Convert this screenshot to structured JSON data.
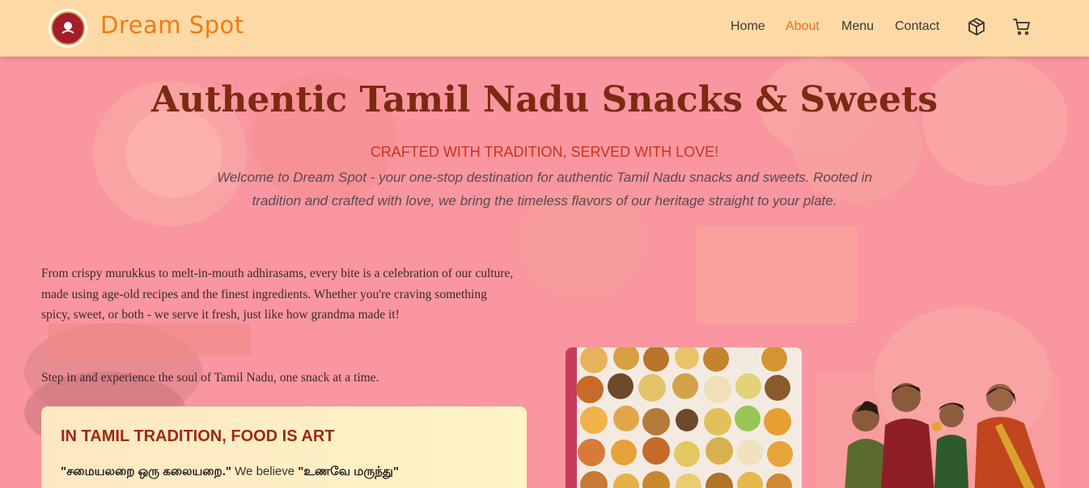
{
  "nav": {
    "brand": "Dream Spot",
    "items": [
      {
        "label": "Home"
      },
      {
        "label": "About"
      },
      {
        "label": "Menu"
      },
      {
        "label": "Contact"
      }
    ]
  },
  "hero": {
    "title": "Authentic Tamil Nadu Snacks & Sweets",
    "subtitle": "CRAFTED WITH TRADITION, SERVED WITH LOVE!",
    "description": "Welcome to Dream Spot - your one-stop destination for authentic Tamil Nadu snacks and sweets. Rooted in tradition and crafted with love, we bring the timeless flavors of our heritage straight to your plate."
  },
  "about": {
    "paragraph1": "From crispy murukkus to melt-in-mouth adhirasams, every bite is a celebration of our culture, made using age-old recipes and the finest ingredients. Whether you're craving something spicy, sweet, or both - we serve it fresh, just like how grandma made it!",
    "paragraph2": "Step in and experience the soul of Tamil Nadu, one snack at a time."
  },
  "card": {
    "title": "IN TAMIL TRADITION, FOOD IS ART",
    "quote1": "\"சமையலறை ஒரு கலையறை.\"",
    "text1": " We believe ",
    "quote2": "\"உணவே மருந்து\""
  },
  "colors": {
    "nav_bg": "#fdd9a6",
    "accent": "#f07b12",
    "page_bg": "#f9949e",
    "title": "#7c2a12"
  },
  "icons": [
    "box-icon",
    "cart-icon"
  ]
}
